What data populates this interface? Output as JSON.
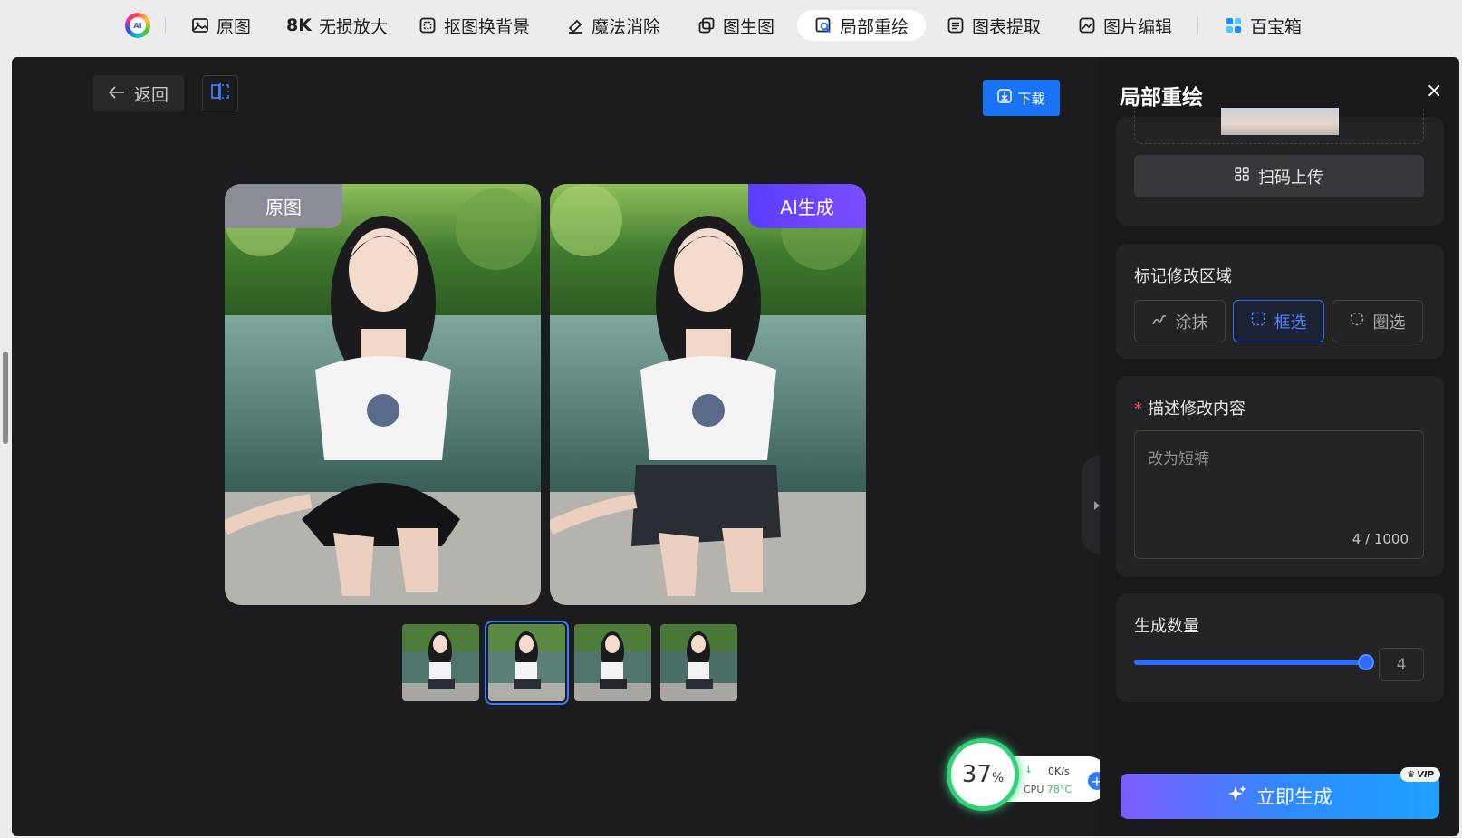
{
  "nav": {
    "items": [
      {
        "label": "原图",
        "icon": "image-icon"
      },
      {
        "label": "无损放大",
        "prefix": "8K",
        "icon": "8k-icon"
      },
      {
        "label": "抠图换背景",
        "icon": "cutout-icon"
      },
      {
        "label": "魔法消除",
        "icon": "eraser-icon"
      },
      {
        "label": "图生图",
        "icon": "image-to-image-icon"
      },
      {
        "label": "局部重绘",
        "icon": "partial-redraw-icon",
        "active": true
      },
      {
        "label": "图表提取",
        "icon": "chart-extract-icon"
      },
      {
        "label": "图片编辑",
        "icon": "image-edit-icon"
      },
      {
        "label": "百宝箱",
        "icon": "toolbox-icon"
      }
    ]
  },
  "toolbar": {
    "back_label": "返回",
    "download_label": "下载"
  },
  "compare": {
    "left_tag": "原图",
    "right_tag": "AI生成"
  },
  "thumbnails": {
    "count": 4,
    "selected_index": 1
  },
  "side": {
    "title": "局部重绘",
    "close": "×",
    "scan_upload_label": "扫码上传",
    "mark_area": {
      "label": "标记修改区域",
      "modes": [
        {
          "label": "涂抹",
          "icon": "brush-icon"
        },
        {
          "label": "框选",
          "icon": "rect-select-icon",
          "active": true
        },
        {
          "label": "圈选",
          "icon": "circle-select-icon"
        }
      ]
    },
    "describe": {
      "required_mark": "*",
      "label": "描述修改内容",
      "value": "改为短裤",
      "counter": "4 / 1000"
    },
    "count": {
      "label": "生成数量",
      "value": "4",
      "slider_fraction": 1.0
    },
    "generate_label": "立即生成",
    "vip_badge": "VIP"
  },
  "monitor": {
    "cpu_percent": "37",
    "percent_sign": "%",
    "net_speed": "0K/s",
    "cpu_label": "CPU",
    "cpu_temp": "78°C"
  },
  "colors": {
    "accent": "#2f6bff",
    "download": "#1a73f5",
    "ai_tag": "#6a45ff",
    "panel_bg": "#1c1c1e"
  }
}
